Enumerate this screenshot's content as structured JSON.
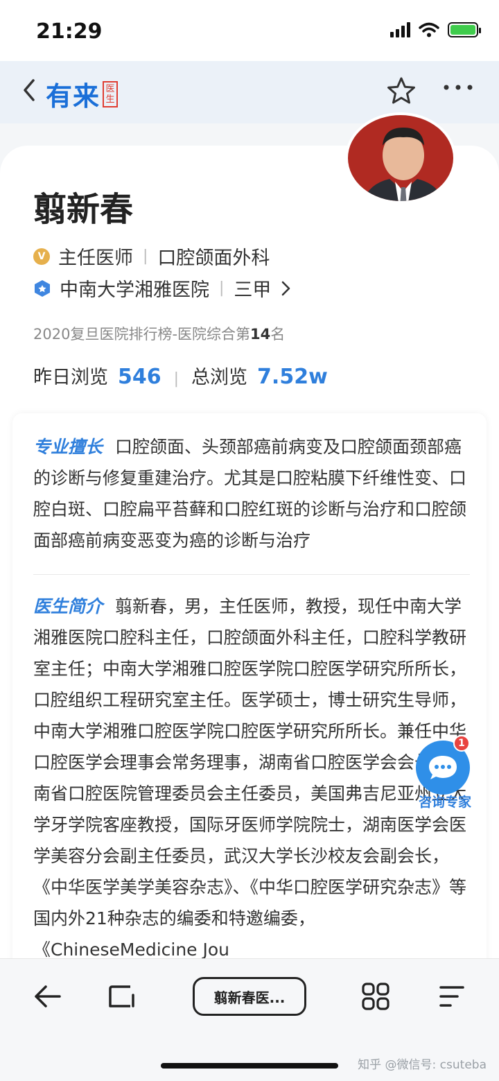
{
  "status_bar": {
    "time": "21:29"
  },
  "nav": {
    "logo_text": "有来",
    "logo_badge": "医生"
  },
  "profile": {
    "name": "翦新春",
    "title": "主任医师",
    "department": "口腔颌面外科",
    "hospital": "中南大学湘雅医院",
    "hospital_level": "三甲",
    "rank_prefix": "2020复旦医院排行榜-医院综合第",
    "rank_num": "14",
    "rank_suffix": "名",
    "yesterday_label": "昨日浏览",
    "yesterday_value": "546",
    "total_label": "总浏览",
    "total_value": "7.52w"
  },
  "specialty": {
    "tag": "专业擅长",
    "text": "口腔颌面、头颈部癌前病变及口腔颌面颈部癌的诊断与修复重建治疗。尤其是口腔粘膜下纤维性变、口腔白斑、口腔扁平苔藓和口腔红斑的诊断与治疗和口腔颌面部癌前病变恶变为癌的诊断与治疗"
  },
  "intro": {
    "tag": "医生简介",
    "text": "翦新春，男，主任医师，教授，现任中南大学湘雅医院口腔科主任，口腔颌面外科主任，口腔科学教研室主任；中南大学湘雅口腔医学院口腔医学研究所所长，口腔组织工程研究室主任。医学硕士，博士研究生导师，中南大学湘雅口腔医学院口腔医学研究所所长。兼任中华口腔医学会理事会常务理事，湖南省口腔医学会会长，湖南省口腔医院管理委员会主任委员，美国弗吉尼亚州立大学牙学院客座教授，国际牙医师学院院士，湖南医学会医学美容分会副主任委员，武汉大学长沙校友会副会长，《中华医学美学美容杂志》、《中华口腔医学研究杂志》等国内外21种杂志的编委和特邀编委，《ChineseMedicine Jou"
  },
  "consult": {
    "badge": "1",
    "label": "咨询专家"
  },
  "bottom_bar": {
    "tab_label": "翦新春医..."
  },
  "watermark": "知乎 @微信号: csuteba"
}
